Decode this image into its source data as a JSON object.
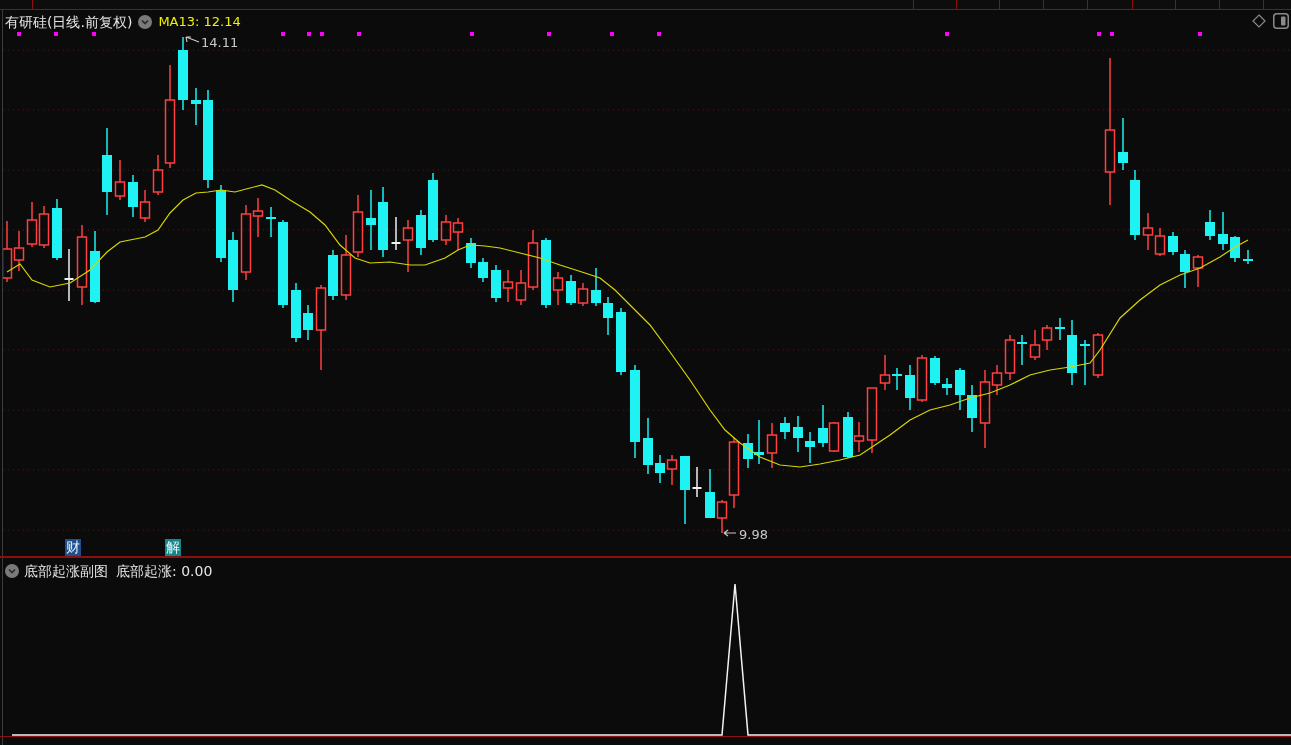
{
  "main_chart": {
    "title": "有研硅(日线.前复权)",
    "indicator": "MA13: 12.14",
    "price_marks": [
      "14.11",
      "9.98"
    ],
    "event_badges": [
      {
        "text": "财",
        "color": "#1d4f8c"
      },
      {
        "text": "解",
        "color": "#138787"
      }
    ]
  },
  "sub_chart": {
    "title": "底部起涨副图",
    "reading": "底部起涨: 0.00"
  }
}
